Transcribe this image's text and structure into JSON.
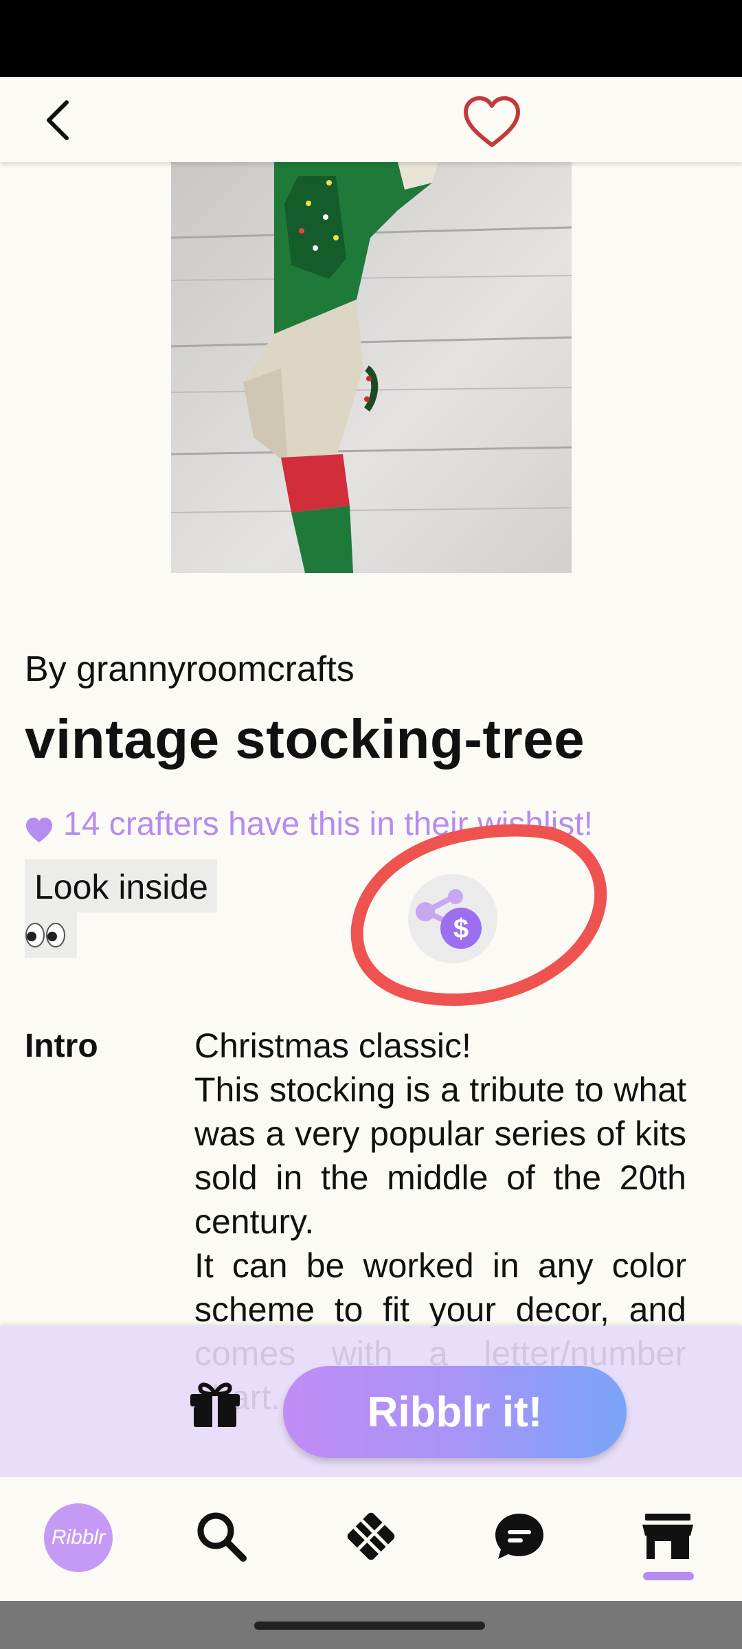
{
  "header": {
    "back_icon": "chevron-left-icon",
    "favorite_icon": "heart-outline-icon",
    "favorite_color": "#c23a3a"
  },
  "product": {
    "byline": "By grannyroomcrafts",
    "title": "vintage stocking-tree",
    "wishlist_text": "14 crafters have this in their wishlist!",
    "look_inside_label": "Look inside",
    "look_inside_emoji": "👀",
    "share_earn_icon": "share-dollar-icon"
  },
  "intro": {
    "label": "Intro",
    "paragraphs": [
      "Christmas classic!",
      "This stocking is a tribute to what was a very popular series of kits sold in the middle of the 20th century.",
      "It can be worked in any color scheme to fit your decor, and comes with a letter/number chart..."
    ]
  },
  "cta": {
    "gift_icon": "gift-icon",
    "button_label": "Ribblr it!"
  },
  "nav": {
    "logo_text": "Ribblr",
    "items": [
      "home-logo",
      "search-icon",
      "patterns-icon",
      "chat-icon",
      "shop-icon"
    ],
    "active": "shop-icon",
    "accent": "#b58cf0"
  },
  "colors": {
    "accent_purple": "#b58cf0",
    "annotation_red": "#ef5350",
    "background": "#fbfaf5"
  }
}
